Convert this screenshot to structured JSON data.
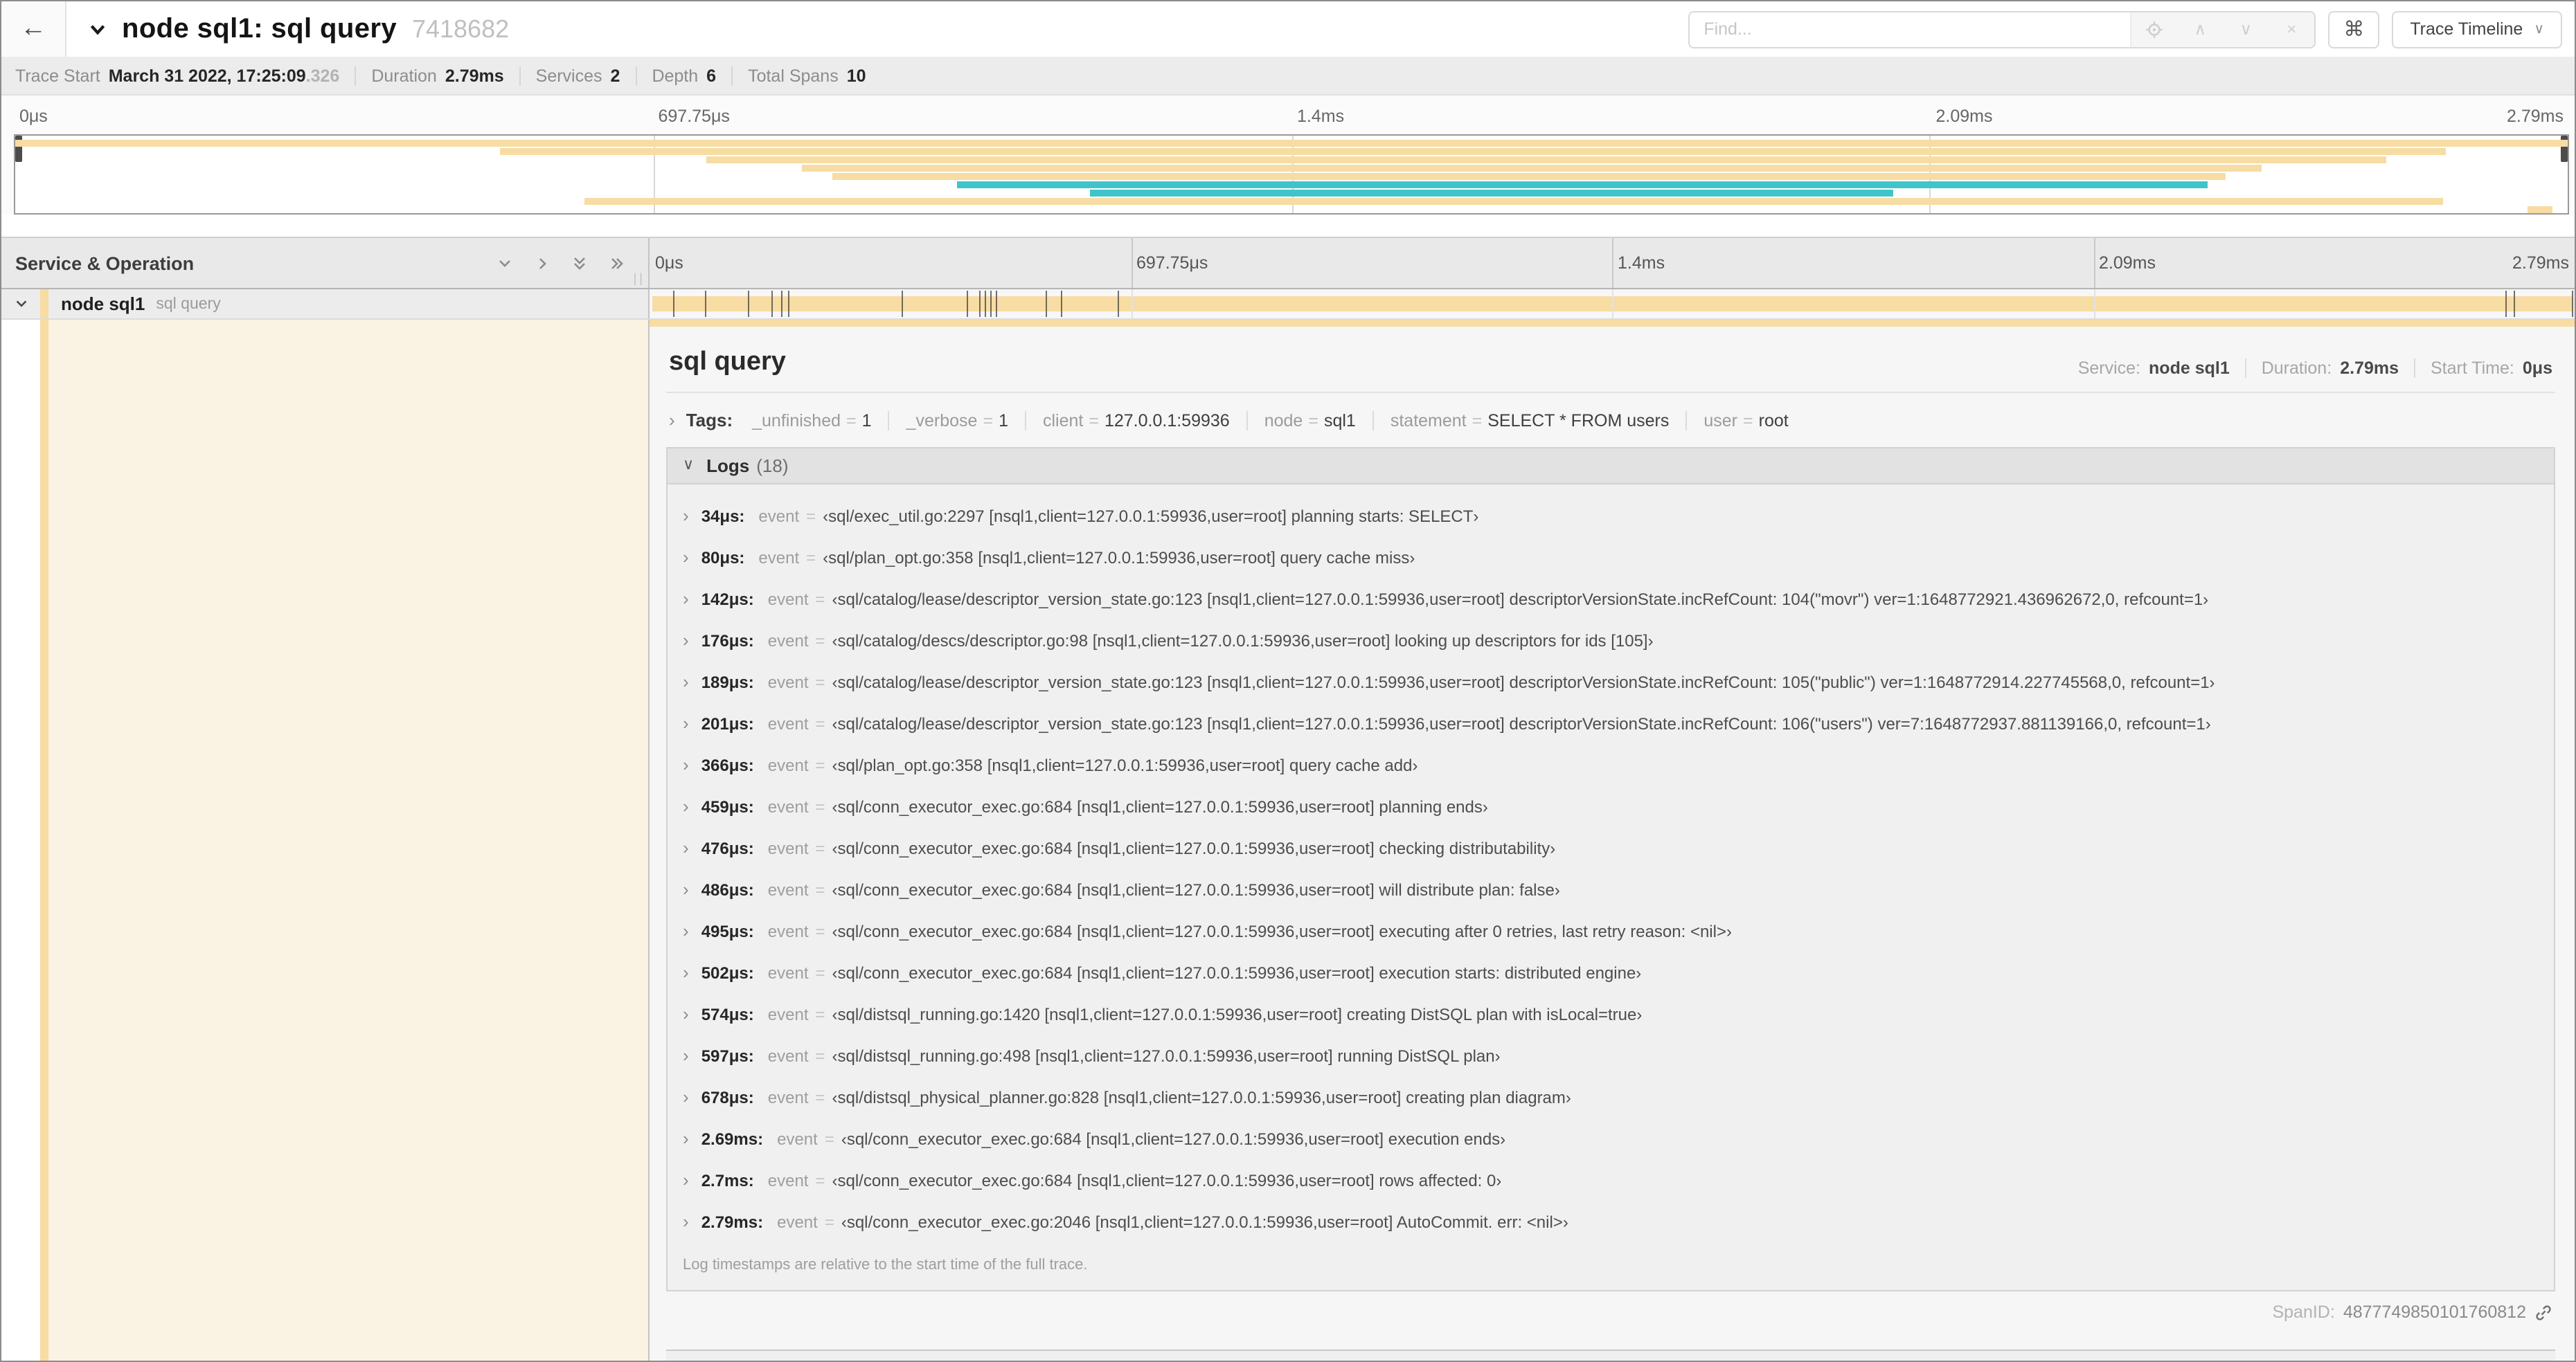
{
  "colors": {
    "tan": "#F7DCA3",
    "teal": "#41C4C9",
    "cream": "#FAF3E3"
  },
  "header": {
    "back_icon": "←",
    "title": "node sql1: sql query",
    "trace_id_short": "7418682",
    "find_placeholder": "Find...",
    "shortcut_icon": "⌘",
    "view_dropdown_label": "Trace Timeline",
    "dropdown_caret": "∨",
    "find_prev_icon": "∧",
    "find_next_icon": "∨",
    "find_clear_icon": "×"
  },
  "summary": {
    "items": [
      {
        "label": "Trace Start",
        "value": "March 31 2022, 17:25:09",
        "suffix": ".326"
      },
      {
        "label": "Duration",
        "value": "2.79ms"
      },
      {
        "label": "Services",
        "value": "2"
      },
      {
        "label": "Depth",
        "value": "6"
      },
      {
        "label": "Total Spans",
        "value": "10"
      }
    ]
  },
  "ruler": {
    "ticks": [
      "0μs",
      "697.75μs",
      "1.4ms",
      "2.09ms",
      "2.79ms"
    ],
    "positions": [
      0,
      25,
      50,
      75,
      100
    ],
    "gridlines": [
      25,
      50,
      75
    ]
  },
  "minimap": {
    "rows": [
      {
        "color": "tan",
        "row": 0,
        "start": 0,
        "end": 100
      },
      {
        "color": "tan",
        "row": 1,
        "start": 19,
        "end": 95.2
      },
      {
        "color": "tan",
        "row": 2,
        "start": 27.1,
        "end": 92.9
      },
      {
        "color": "tan",
        "row": 3,
        "start": 30.8,
        "end": 88
      },
      {
        "color": "tan",
        "row": 4,
        "start": 32,
        "end": 86.6
      },
      {
        "color": "teal",
        "row": 5,
        "start": 36.9,
        "end": 85.9
      },
      {
        "color": "teal",
        "row": 6,
        "start": 42.1,
        "end": 73.6
      },
      {
        "color": "tan",
        "row": 7,
        "start": 22.3,
        "end": 95.1
      },
      {
        "color": "tan",
        "row": 8,
        "start": 98.4,
        "end": 99.4
      }
    ]
  },
  "timeline": {
    "left_header": "Service & Operation",
    "row": {
      "service": "node sql1",
      "operation": "sql query"
    },
    "log_marker_pcts": [
      1.2,
      2.9,
      5.1,
      6.3,
      6.8,
      7.2,
      13.1,
      16.5,
      17.1,
      17.4,
      17.7,
      18.0,
      20.6,
      21.4,
      24.3,
      96.4,
      96.8,
      99.85
    ]
  },
  "detail": {
    "operation": "sql query",
    "meta": [
      {
        "label": "Service:",
        "value": "node sql1"
      },
      {
        "label": "Duration:",
        "value": "2.79ms"
      },
      {
        "label": "Start Time:",
        "value": "0μs"
      }
    ],
    "tags_label": "Tags:",
    "tags": [
      {
        "key": "_unfinished",
        "value": "1"
      },
      {
        "key": "_verbose",
        "value": "1"
      },
      {
        "key": "client",
        "value": "127.0.0.1:59936"
      },
      {
        "key": "node",
        "value": "sql1"
      },
      {
        "key": "statement",
        "value": "SELECT * FROM users"
      },
      {
        "key": "user",
        "value": "root"
      }
    ],
    "logs_label": "Logs",
    "logs_count": "(18)",
    "logs": [
      {
        "t": "34μs:",
        "key": "event",
        "value": "‹sql/exec_util.go:2297 [nsql1,client=127.0.0.1:59936,user=root] planning starts: SELECT›"
      },
      {
        "t": "80μs:",
        "key": "event",
        "value": "‹sql/plan_opt.go:358 [nsql1,client=127.0.0.1:59936,user=root] query cache miss›"
      },
      {
        "t": "142μs:",
        "key": "event",
        "value": "‹sql/catalog/lease/descriptor_version_state.go:123 [nsql1,client=127.0.0.1:59936,user=root] descriptorVersionState.incRefCount: 104(\"movr\") ver=1:1648772921.436962672,0, refcount=1›"
      },
      {
        "t": "176μs:",
        "key": "event",
        "value": "‹sql/catalog/descs/descriptor.go:98 [nsql1,client=127.0.0.1:59936,user=root] looking up descriptors for ids [105]›"
      },
      {
        "t": "189μs:",
        "key": "event",
        "value": "‹sql/catalog/lease/descriptor_version_state.go:123 [nsql1,client=127.0.0.1:59936,user=root] descriptorVersionState.incRefCount: 105(\"public\") ver=1:1648772914.227745568,0, refcount=1›"
      },
      {
        "t": "201μs:",
        "key": "event",
        "value": "‹sql/catalog/lease/descriptor_version_state.go:123 [nsql1,client=127.0.0.1:59936,user=root] descriptorVersionState.incRefCount: 106(\"users\") ver=7:1648772937.881139166,0, refcount=1›"
      },
      {
        "t": "366μs:",
        "key": "event",
        "value": "‹sql/plan_opt.go:358 [nsql1,client=127.0.0.1:59936,user=root] query cache add›"
      },
      {
        "t": "459μs:",
        "key": "event",
        "value": "‹sql/conn_executor_exec.go:684 [nsql1,client=127.0.0.1:59936,user=root] planning ends›"
      },
      {
        "t": "476μs:",
        "key": "event",
        "value": "‹sql/conn_executor_exec.go:684 [nsql1,client=127.0.0.1:59936,user=root] checking distributability›"
      },
      {
        "t": "486μs:",
        "key": "event",
        "value": "‹sql/conn_executor_exec.go:684 [nsql1,client=127.0.0.1:59936,user=root] will distribute plan: false›"
      },
      {
        "t": "495μs:",
        "key": "event",
        "value": "‹sql/conn_executor_exec.go:684 [nsql1,client=127.0.0.1:59936,user=root] executing after 0 retries, last retry reason: <nil>›"
      },
      {
        "t": "502μs:",
        "key": "event",
        "value": "‹sql/conn_executor_exec.go:684 [nsql1,client=127.0.0.1:59936,user=root] execution starts: distributed engine›"
      },
      {
        "t": "574μs:",
        "key": "event",
        "value": "‹sql/distsql_running.go:1420 [nsql1,client=127.0.0.1:59936,user=root] creating DistSQL plan with isLocal=true›"
      },
      {
        "t": "597μs:",
        "key": "event",
        "value": "‹sql/distsql_running.go:498 [nsql1,client=127.0.0.1:59936,user=root] running DistSQL plan›"
      },
      {
        "t": "678μs:",
        "key": "event",
        "value": "‹sql/distsql_physical_planner.go:828 [nsql1,client=127.0.0.1:59936,user=root] creating plan diagram›"
      },
      {
        "t": "2.69ms:",
        "key": "event",
        "value": "‹sql/conn_executor_exec.go:684 [nsql1,client=127.0.0.1:59936,user=root] execution ends›"
      },
      {
        "t": "2.7ms:",
        "key": "event",
        "value": "‹sql/conn_executor_exec.go:684 [nsql1,client=127.0.0.1:59936,user=root] rows affected: 0›"
      },
      {
        "t": "2.79ms:",
        "key": "event",
        "value": "‹sql/conn_executor_exec.go:2046 [nsql1,client=127.0.0.1:59936,user=root] AutoCommit. err: <nil>›"
      }
    ],
    "footnote": "Log timestamps are relative to the start time of the full trace.",
    "span_id_label": "SpanID:",
    "span_id": "4877749850101760812"
  }
}
